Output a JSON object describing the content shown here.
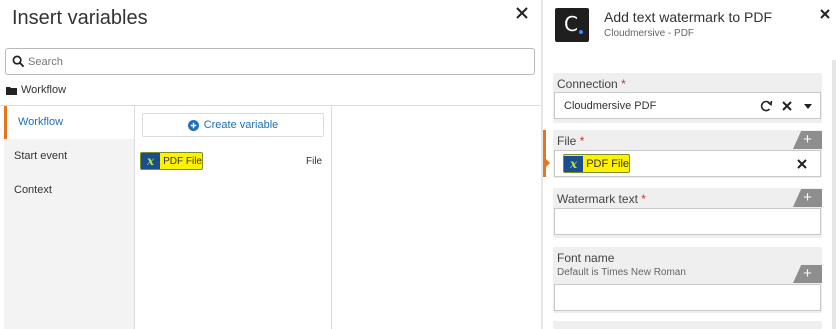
{
  "left_panel": {
    "title": "Insert variables",
    "search": {
      "placeholder": "Search",
      "value": ""
    },
    "breadcrumb": "Workflow",
    "nav": [
      {
        "label": "Workflow",
        "active": true
      },
      {
        "label": "Start event",
        "active": false
      },
      {
        "label": "Context",
        "active": false
      }
    ],
    "create_variable_label": "Create variable",
    "variables": [
      {
        "badge": "x",
        "name": "PDF File",
        "type": "File"
      }
    ]
  },
  "right_panel": {
    "title": "Add text watermark to PDF",
    "subtitle": "Cloudmersive - PDF",
    "logo_letter": "C",
    "fields": {
      "connection": {
        "label": "Connection",
        "required_mark": "*",
        "value": "Cloudmersive PDF"
      },
      "file": {
        "label": "File",
        "required_mark": "*",
        "chip_badge": "x",
        "chip_label": "PDF File"
      },
      "watermark_text": {
        "label": "Watermark text",
        "required_mark": "*",
        "value": ""
      },
      "font_name": {
        "label": "Font name",
        "hint": "Default is Times New Roman",
        "value": ""
      }
    },
    "add_symbol": "+"
  },
  "colors": {
    "accent_orange": "#e5751f",
    "link_blue": "#1d6fb8",
    "chip_yellow": "#fff200",
    "badge_navy": "#1b4f8c",
    "badge_green": "#b7e234",
    "required_red": "#c0392b"
  },
  "icons": {
    "left_close": "close-icon",
    "search": "search-icon",
    "folder": "folder-icon",
    "create": "plus-circle-icon",
    "right_close": "close-icon",
    "refresh": "refresh-icon",
    "clear": "clear-icon",
    "dropdown": "chevron-down-icon",
    "add": "plus-icon"
  }
}
